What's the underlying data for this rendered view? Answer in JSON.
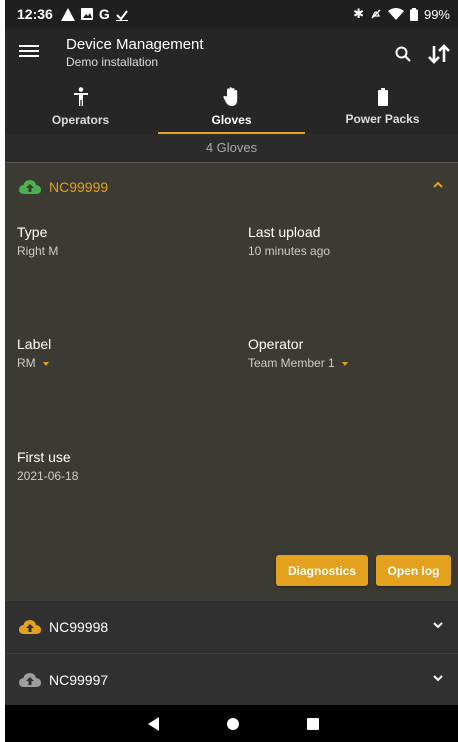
{
  "status_bar": {
    "time": "12:36",
    "left_icons": [
      "alert-icon",
      "image-icon",
      "google-icon",
      "download-icon"
    ],
    "right_icons": [
      "bluetooth-icon",
      "mute-icon",
      "wifi-icon",
      "battery-icon"
    ],
    "battery": "99%"
  },
  "app_bar": {
    "title": "Device Management",
    "subtitle": "Demo installation",
    "icons": [
      "menu-icon",
      "search-icon",
      "sort-icon"
    ]
  },
  "tabs": [
    {
      "label": "Operators",
      "icon": "person-icon",
      "active": false
    },
    {
      "label": "Gloves",
      "icon": "hand-icon",
      "active": true
    },
    {
      "label": "Power Packs",
      "icon": "battery-pack-icon",
      "active": false
    }
  ],
  "count_label": "4 Gloves",
  "colors": {
    "accent": "#e3a11d",
    "upload_ok": "#4caf50",
    "upload_pending": "#e3a11d",
    "upload_none": "#9e9e9e"
  },
  "expanded_item": {
    "code": "NC99999",
    "cloud_state": "green",
    "fields": {
      "type_label": "Type",
      "type_value": "Right M",
      "last_upload_label": "Last upload",
      "last_upload_value": "10 minutes ago",
      "label_label": "Label",
      "label_value": "RM",
      "operator_label": "Operator",
      "operator_value": "Team Member 1",
      "first_use_label": "First use",
      "first_use_value": "2021-06-18"
    },
    "buttons": {
      "diagnostics": "Diagnostics",
      "open_log": "Open log"
    }
  },
  "collapsed_items": [
    {
      "code": "NC99998",
      "cloud_state": "orange"
    },
    {
      "code": "NC99997",
      "cloud_state": "grey"
    }
  ],
  "nav_bar": [
    "back-icon",
    "home-icon",
    "recents-icon"
  ]
}
